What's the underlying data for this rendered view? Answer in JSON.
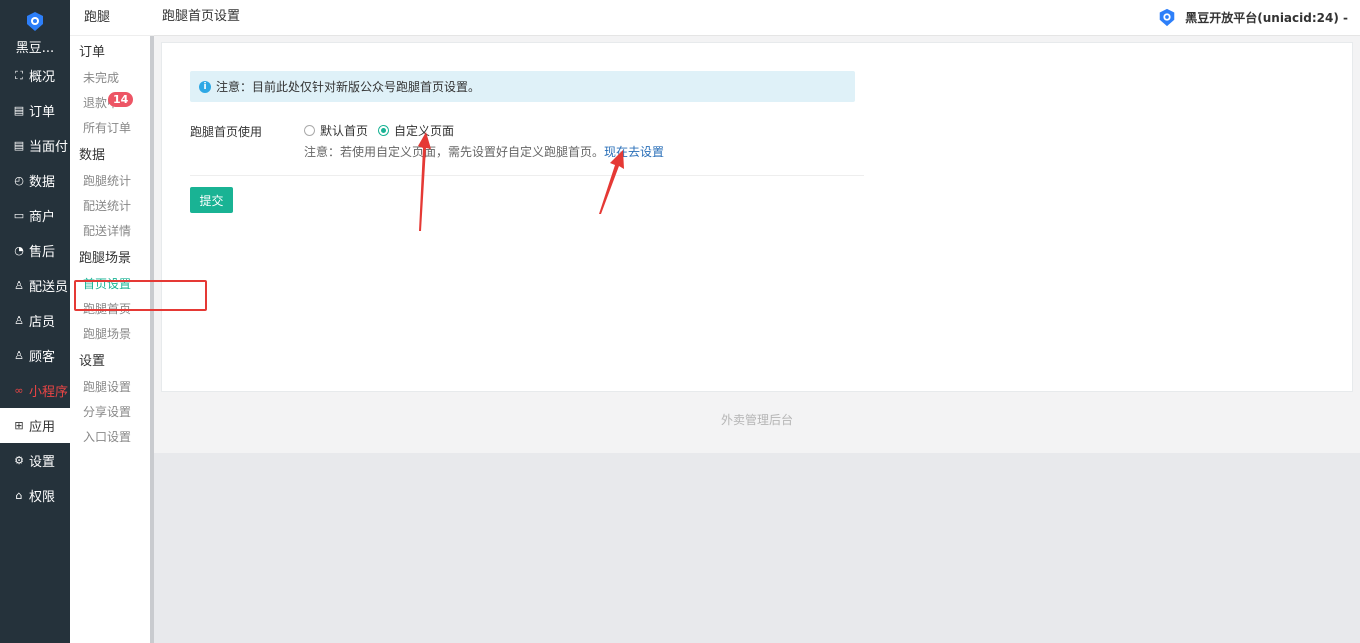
{
  "brand": {
    "name": "黑豆..."
  },
  "nav": [
    {
      "label": "概况",
      "icon": "overview-icon",
      "glyph": "⛶"
    },
    {
      "label": "订单",
      "icon": "order-icon",
      "glyph": "▤"
    },
    {
      "label": "当面付",
      "icon": "pay-icon",
      "glyph": "▤"
    },
    {
      "label": "数据",
      "icon": "data-icon",
      "glyph": "◴"
    },
    {
      "label": "商户",
      "icon": "shop-icon",
      "glyph": "▭"
    },
    {
      "label": "售后",
      "icon": "aftersale-icon",
      "glyph": "◔"
    },
    {
      "label": "配送员",
      "icon": "courier-icon",
      "glyph": "♙"
    },
    {
      "label": "店员",
      "icon": "clerk-icon",
      "glyph": "♙"
    },
    {
      "label": "顾客",
      "icon": "customer-icon",
      "glyph": "♙"
    },
    {
      "label": "小程序",
      "icon": "miniprogram-icon",
      "glyph": "∞"
    },
    {
      "label": "应用",
      "icon": "apps-icon",
      "glyph": "⊞"
    },
    {
      "label": "设置",
      "icon": "settings-icon",
      "glyph": "⚙"
    },
    {
      "label": "权限",
      "icon": "lock-icon",
      "glyph": "⌂"
    }
  ],
  "sub": {
    "title": "跑腿",
    "groups": [
      {
        "name": "订单",
        "items": [
          {
            "label": "未完成"
          },
          {
            "label": "退款中",
            "badge": "14"
          },
          {
            "label": "所有订单"
          }
        ]
      },
      {
        "name": "数据",
        "items": [
          {
            "label": "跑腿统计"
          },
          {
            "label": "配送统计"
          },
          {
            "label": "配送详情"
          }
        ]
      },
      {
        "name": "跑腿场景",
        "items": [
          {
            "label": "首页设置"
          },
          {
            "label": "跑腿首页"
          },
          {
            "label": "跑腿场景"
          }
        ]
      },
      {
        "name": "设置",
        "items": [
          {
            "label": "跑腿设置"
          },
          {
            "label": "分享设置"
          },
          {
            "label": "入口设置"
          }
        ]
      }
    ]
  },
  "header": {
    "title": "跑腿首页设置",
    "platform": "黑豆开放平台(uniacid:24) -"
  },
  "main": {
    "alert": "注意：目前此处仅针对新版公众号跑腿首页设置。",
    "form_label": "跑腿首页使用",
    "radio_default": "默认首页",
    "radio_custom": "自定义页面",
    "note": "注意：若使用自定义页面，需先设置好自定义跑腿首页。",
    "note_link": "现在去设置",
    "submit": "提交"
  },
  "footer": "外卖管理后台",
  "colors": {
    "accent": "#19b394",
    "sidebar": "#25323b",
    "annotation": "#e53935"
  }
}
